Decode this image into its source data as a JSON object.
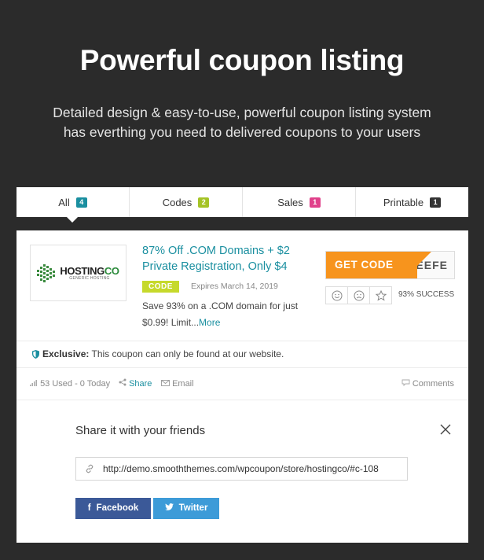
{
  "hero": {
    "title": "Powerful coupon listing",
    "subtitle_line1": "Detailed design & easy-to-use, powerful coupon listing system",
    "subtitle_line2": "has everthing you need to delivered coupons to your users"
  },
  "tabs": [
    {
      "label": "All",
      "count": "4",
      "color": "#1a8fa0",
      "active": true
    },
    {
      "label": "Codes",
      "count": "2",
      "color": "#a5c326"
    },
    {
      "label": "Sales",
      "count": "1",
      "color": "#e0408a"
    },
    {
      "label": "Printable",
      "count": "1",
      "color": "#333333"
    }
  ],
  "coupon": {
    "logo": {
      "word": "HOSTING",
      "word_accent": "CO",
      "tagline": "GENERIC HOSTING"
    },
    "title_line1": "87% Off .COM Domains + $2",
    "title_line2": "Private Registration, Only $4",
    "type_label": "CODE",
    "expires": "Expires March 14, 2019",
    "description": "Save 93% on a .COM domain for just $0.99! Limit...",
    "more_label": "More",
    "get_code_label": "GET CODE",
    "code_peek": "EEFE",
    "success": "93% SUCCESS",
    "exclusive_label": "Exclusive:",
    "exclusive_text": " This coupon can only be found at our website.",
    "used": "53 Used - 0 Today",
    "share_label": "Share",
    "email_label": "Email",
    "comments_label": "Comments"
  },
  "share_panel": {
    "title": "Share it with your friends",
    "url": "http://demo.smooththemes.com/wpcoupon/store/hostingco/#c-108",
    "facebook_label": "Facebook",
    "twitter_label": "Twitter"
  },
  "colors": {
    "accent": "#1a8fa0",
    "get_code": "#f7941d",
    "code_badge": "#c6d92b",
    "facebook": "#3b5998",
    "twitter": "#3d9bd8"
  }
}
